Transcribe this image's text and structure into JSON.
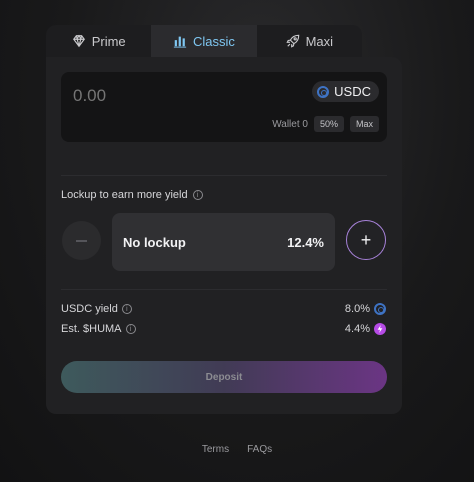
{
  "tabs": [
    {
      "label": "Prime",
      "icon": "diamond-icon",
      "active": false
    },
    {
      "label": "Classic",
      "icon": "bar-chart-icon",
      "active": true
    },
    {
      "label": "Maxi",
      "icon": "rocket-icon",
      "active": false
    }
  ],
  "deposit_input": {
    "placeholder": "0.00",
    "token": "USDC",
    "wallet_label": "Wallet 0",
    "quick_50": "50%",
    "quick_max": "Max"
  },
  "lockup": {
    "title": "Lockup to earn more yield",
    "option_label": "No lockup",
    "option_rate": "12.4%",
    "minus_symbol": "−",
    "plus_symbol": "+"
  },
  "stats": {
    "usdc_yield_label": "USDC yield",
    "usdc_yield_value": "8.0%",
    "huma_label": "Est. $HUMA",
    "huma_value": "4.4%"
  },
  "deposit_button": "Deposit",
  "footer": {
    "terms": "Terms",
    "faqs": "FAQs"
  },
  "colors": {
    "active_tab_text": "#7fc7f2",
    "plus_border": "#a782d9",
    "usdc_blue": "#3e73c4",
    "huma_purple": "#b64be6"
  }
}
